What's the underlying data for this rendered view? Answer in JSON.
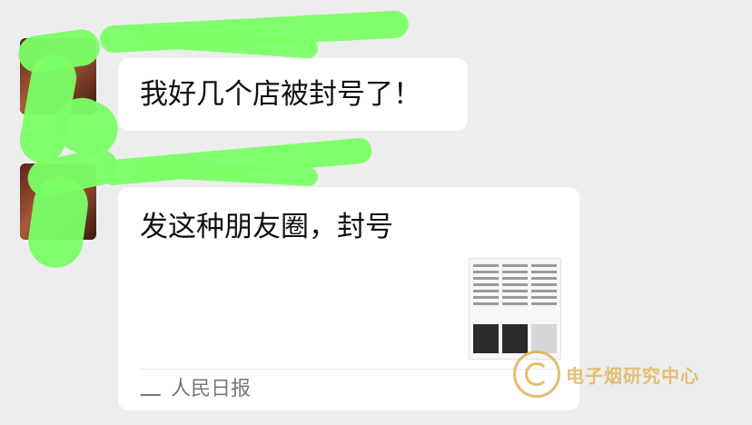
{
  "chat": {
    "messages": [
      {
        "text": "我好几个店被封号了！"
      },
      {
        "text": "发这种朋友圈，封号",
        "card_source": "人民日报"
      }
    ]
  },
  "watermark": {
    "text": "电子烟研究中心"
  },
  "colors": {
    "redaction": "#7bff66",
    "watermark": "#e2b660",
    "background": "#ededed"
  }
}
